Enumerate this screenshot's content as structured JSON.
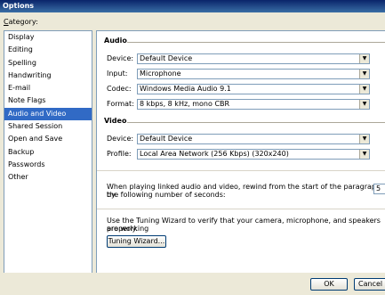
{
  "window": {
    "title": "Options"
  },
  "category": {
    "label_prefix": "C",
    "label_rest": "ategory:"
  },
  "sidebar": {
    "items": [
      {
        "label": "Display"
      },
      {
        "label": "Editing"
      },
      {
        "label": "Spelling"
      },
      {
        "label": "Handwriting"
      },
      {
        "label": "E-mail"
      },
      {
        "label": "Note Flags"
      },
      {
        "label": "Audio and Video",
        "selected": true
      },
      {
        "label": "Shared Session"
      },
      {
        "label": "Open and Save"
      },
      {
        "label": "Backup"
      },
      {
        "label": "Passwords"
      },
      {
        "label": "Other"
      }
    ]
  },
  "audio": {
    "title": "Audio",
    "device": {
      "label": "Device:",
      "value": "Default Device"
    },
    "input": {
      "label": "Input:",
      "value": "Microphone"
    },
    "codec": {
      "label": "Codec:",
      "value": "Windows Media Audio 9.1"
    },
    "format": {
      "label": "Format:",
      "value": "8 kbps, 8 kHz, mono CBR"
    }
  },
  "video": {
    "title": "Video",
    "device": {
      "label": "Device:",
      "value": "Default Device"
    },
    "profile": {
      "label": "Profile:",
      "value": "Local Area Network (256 Kbps) (320x240)"
    }
  },
  "rewind": {
    "text_line1": "When playing linked audio and video, rewind from the start of the paragraph by",
    "text_line2": "the following number of seconds:",
    "value": "5"
  },
  "tuning": {
    "text_line1": "Use the Tuning Wizard to verify that your camera, microphone, and speakers are working",
    "text_line2": "properly.",
    "button": "Tuning Wizard..."
  },
  "footer": {
    "ok": "OK",
    "cancel": "Cancel"
  },
  "colors": {
    "title_bar": "#0a246a",
    "selection": "#316ac5",
    "dialog_bg": "#ece9d8"
  }
}
